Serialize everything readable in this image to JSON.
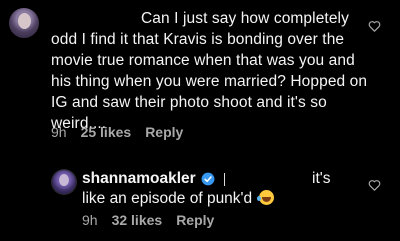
{
  "comment1": {
    "text": "Can I just say how completely odd I find it that Kravis is bonding over the movie true romance when that was you and his thing when you were married? Hopped on IG and saw their photo shoot and it's so weird....",
    "time": "9h",
    "likes": "25 likes",
    "reply": "Reply"
  },
  "comment2": {
    "username": "shannamoakler",
    "text_part1": "it's",
    "text_part2": "like an episode of punk'd",
    "time": "9h",
    "likes": "32 likes",
    "reply": "Reply"
  },
  "icons": {
    "like": "heart-outline-icon",
    "verified": "verified-badge-icon",
    "emoji": "tears-of-joy-emoji"
  },
  "colors": {
    "background": "#000000",
    "text": "#f5f5f5",
    "meta": "#a8a8a8",
    "verified": "#3897f0"
  }
}
